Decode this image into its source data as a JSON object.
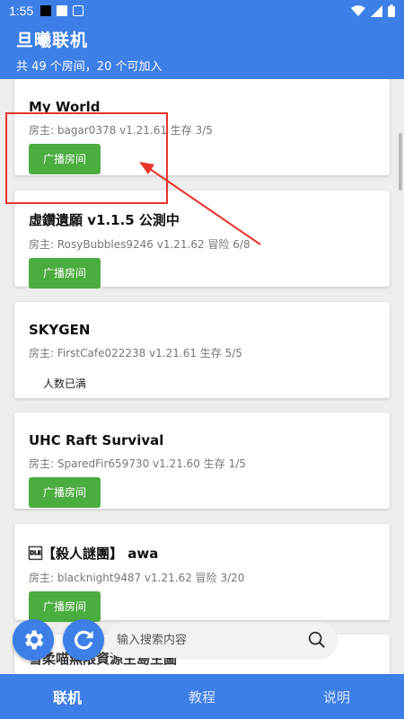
{
  "status_bar": {
    "time": "1:55"
  },
  "header": {
    "title": "旦曦联机",
    "subtitle": "共 49 个房间，20 个可加入"
  },
  "rooms": [
    {
      "name": "My World",
      "host": "房主: bagar0378 v1.21.61 生存 3/5",
      "action": "广播房间"
    },
    {
      "name": "虛鑽遺願 v1.1.5 公測中",
      "host": "房主: RosyBubbles9246 v1.21.62 冒险 6/8",
      "action": "广播房间"
    },
    {
      "name": "SKYGEN",
      "host": "房主: FirstCafe022238 v1.21.61 生存 5/5",
      "status": "人数已满"
    },
    {
      "name": "UHC Raft Survival",
      "host": "房主: SparedFir659730 v1.21.60 生存 1/5",
      "action": "广播房间"
    },
    {
      "name": "\u0010【殺人謎團】 awa",
      "host": "房主: blacknight9487 v1.21.62 冒险 3/20",
      "action": "广播房间"
    }
  ],
  "partial_room_name": "雪柔喵無限資源生島生圖",
  "search": {
    "placeholder": "输入搜索内容"
  },
  "nav": {
    "tabs": [
      "联机",
      "教程",
      "说明"
    ],
    "active": "联机"
  },
  "colors": {
    "primary": "#3d7fe6",
    "button_green": "#4bac3f",
    "annotation_red": "#e8332b"
  }
}
